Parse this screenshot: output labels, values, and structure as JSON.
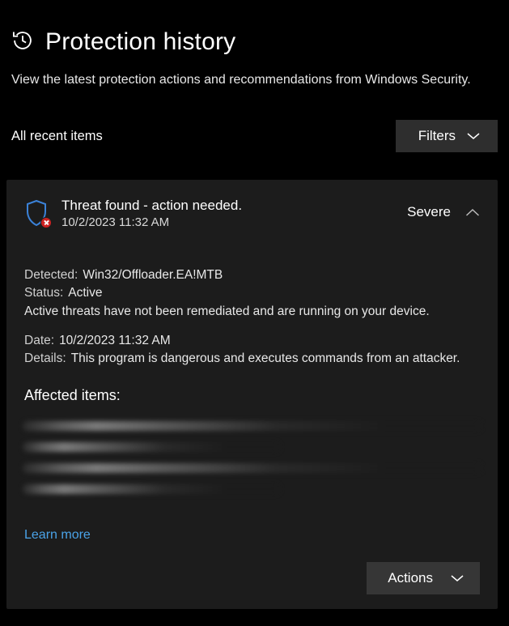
{
  "page": {
    "title": "Protection history",
    "subtitle": "View the latest protection actions and recommendations from Windows Security."
  },
  "filter_bar": {
    "recent_label": "All recent items",
    "filters_button": "Filters"
  },
  "threat": {
    "title": "Threat found - action needed.",
    "timestamp": "10/2/2023 11:32 AM",
    "severity": "Severe",
    "detected_label": "Detected:",
    "detected_value": "Win32/Offloader.EA!MTB",
    "status_label": "Status:",
    "status_value": "Active",
    "status_note": "Active threats have not been remediated and are running on your device.",
    "date_label": "Date:",
    "date_value": "10/2/2023 11:32 AM",
    "details_label": "Details:",
    "details_value": "This program is dangerous and executes commands from an attacker.",
    "affected_heading": "Affected items:",
    "learn_more": "Learn more",
    "actions_button": "Actions"
  }
}
